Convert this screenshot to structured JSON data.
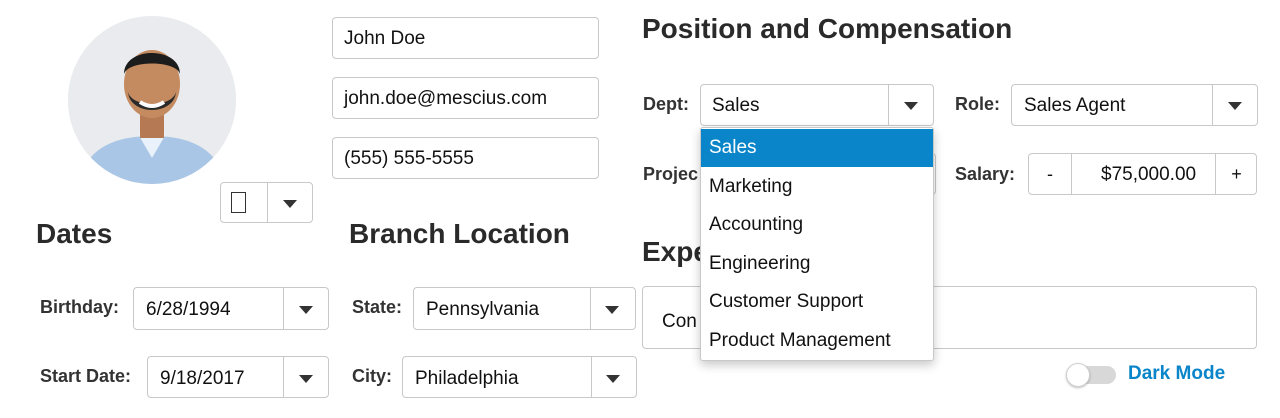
{
  "profile": {
    "name": "John Doe",
    "email": "john.doe@mescius.com",
    "phone": "(555) 555-5555",
    "photo_icon": "user-photo"
  },
  "dates": {
    "heading": "Dates",
    "birthday_label": "Birthday:",
    "birthday_value": "6/28/1994",
    "start_label": "Start Date:",
    "start_value": "9/18/2017"
  },
  "branch": {
    "heading": "Branch Location",
    "state_label": "State:",
    "state_value": "Pennsylvania",
    "city_label": "City:",
    "city_value": "Philadelphia"
  },
  "position": {
    "heading": "Position and Compensation",
    "dept_label": "Dept:",
    "dept_value": "Sales",
    "role_label": "Role:",
    "role_value": "Sales Agent",
    "project_label_partial": "Projec",
    "salary_label": "Salary:",
    "salary_value": "$75,000.00",
    "salary_minus": "-",
    "salary_plus": "+"
  },
  "expertise": {
    "heading_partial": "Expe",
    "value_partial": "Con"
  },
  "dept_dropdown": {
    "selected_index": 0,
    "options": [
      "Sales",
      "Marketing",
      "Accounting",
      "Engineering",
      "Customer Support",
      "Product Management"
    ]
  },
  "dark_mode": {
    "label": "Dark Mode",
    "on": false,
    "accent": "#0a85c9"
  },
  "colors": {
    "selection": "#0a85c9",
    "border": "#c8c8c8"
  }
}
